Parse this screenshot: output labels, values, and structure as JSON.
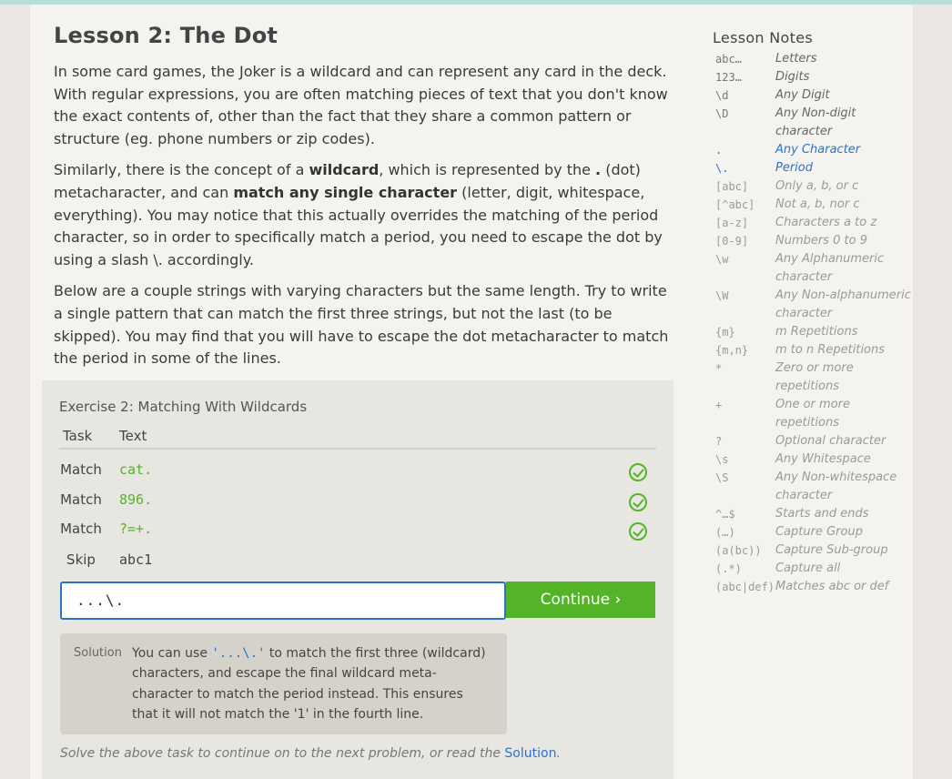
{
  "lesson": {
    "title": "Lesson 2: The Dot",
    "p1": "In some card games, the Joker is a wildcard and can represent any card in the deck. With regular expressions, you are often matching pieces of text that you don't know the exact contents of, other than the fact that they share a common pattern or structure (eg. phone numbers or zip codes).",
    "p2": {
      "a": "Similarly, there is the concept of a ",
      "b": "wildcard",
      "c": ", which is represented by the ",
      "d": ".",
      "e": " (dot) metacharacter, and can ",
      "f": "match any single character",
      "g": " (letter, digit, whitespace, everything). You may notice that this actually overrides the matching of the period character, so in order to specifically match a period, you need to escape the dot by using a slash \\. accordingly."
    },
    "p3": "Below are a couple strings with varying characters but the same length. Try to write a single pattern that can match the first three strings, but not the last (to be skipped). You may find that you will have to escape the dot metacharacter to match the period in some of the lines."
  },
  "exercise": {
    "title": "Exercise 2: Matching With Wildcards",
    "col_task": "Task",
    "col_text": "Text",
    "rows": [
      {
        "task": "Match",
        "text": "cat."
      },
      {
        "task": "Match",
        "text": "896."
      },
      {
        "task": "Match",
        "text": "?=+."
      },
      {
        "task": "Skip",
        "text": "abc1"
      }
    ],
    "input_value": "...\\.",
    "continue_label": "Continue ›",
    "solution_label": "Solution",
    "solution_pre": "You can use ",
    "solution_code": "'...\\.'",
    "solution_post": " to match the first three (wildcard) characters, and escape the final wildcard meta-character to match the period instead. This ensures that it will not match the '1' in the fourth line.",
    "footer_pre": "Solve the above task to continue on to the next problem, or read the ",
    "footer_link": "Solution",
    "footer_post": "."
  },
  "notes": {
    "title": "Lesson Notes",
    "items": [
      {
        "sym": "abc…",
        "desc": "Letters"
      },
      {
        "sym": "123…",
        "desc": "Digits"
      },
      {
        "sym": "\\d",
        "desc": "Any Digit"
      },
      {
        "sym": "\\D",
        "desc": "Any Non-digit character"
      },
      {
        "sym": ".",
        "desc": "Any Character"
      },
      {
        "sym": "\\.",
        "desc": "Period"
      },
      {
        "sym": "[abc]",
        "desc": "Only a, b, or c"
      },
      {
        "sym": "[^abc]",
        "desc": "Not a, b, nor c"
      },
      {
        "sym": "[a-z]",
        "desc": "Characters a to z"
      },
      {
        "sym": "[0-9]",
        "desc": "Numbers 0 to 9"
      },
      {
        "sym": "\\w",
        "desc": "Any Alphanumeric character"
      },
      {
        "sym": "\\W",
        "desc": "Any Non-alphanumeric character"
      },
      {
        "sym": "{m}",
        "desc": "m Repetitions"
      },
      {
        "sym": "{m,n}",
        "desc": "m to n Repetitions"
      },
      {
        "sym": "*",
        "desc": "Zero or more repetitions"
      },
      {
        "sym": "+",
        "desc": "One or more repetitions"
      },
      {
        "sym": "?",
        "desc": "Optional character"
      },
      {
        "sym": "\\s",
        "desc": "Any Whitespace"
      },
      {
        "sym": "\\S",
        "desc": "Any Non-whitespace character"
      },
      {
        "sym": "^…$",
        "desc": "Starts and ends"
      },
      {
        "sym": "(…)",
        "desc": "Capture Group"
      },
      {
        "sym": "(a(bc))",
        "desc": "Capture Sub-group"
      },
      {
        "sym": "(.*)",
        "desc": "Capture all"
      },
      {
        "sym": "(abc|def)",
        "desc": "Matches abc or def"
      }
    ]
  },
  "colors": {
    "accent_blue": "#2c72c8",
    "success_green": "#54b428"
  },
  "icons": {
    "row_status": "check-circle-icon"
  }
}
